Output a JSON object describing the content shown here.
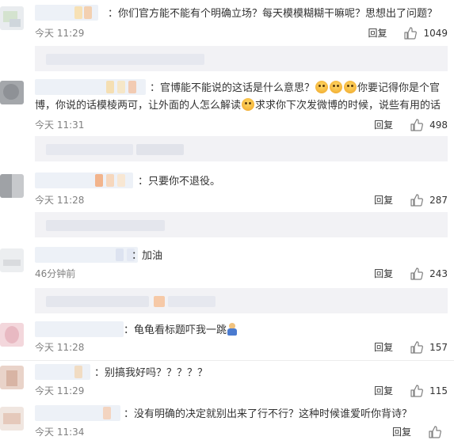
{
  "comments": [
    {
      "text": "你们官方能不能有个明确立场？每天模模糊糊干嘛呢？思想出了问题？",
      "time": "今天 11:29",
      "reply_label": "回复",
      "likes": "1049"
    },
    {
      "text_part1": "官博能不能说的这话是什么意思？",
      "text_part2": "你要记得你是个官博，你说的话模棱两可，让外面的人怎么解读",
      "text_part3": "求求你下次发微博的时候，说些有用的话",
      "time": "今天 11:31",
      "reply_label": "回复",
      "likes": "498"
    },
    {
      "text": "只要你不退役。",
      "time": "今天 11:28",
      "reply_label": "回复",
      "likes": "287"
    },
    {
      "text": "加油",
      "time": "46分钟前",
      "reply_label": "回复",
      "likes": "243"
    },
    {
      "text": "龟龟看标题吓我一跳",
      "time": "今天 11:28",
      "reply_label": "回复",
      "likes": "157"
    },
    {
      "text": "别搞我好吗？？？？？",
      "time": "今天 11:29",
      "reply_label": "回复",
      "likes": "115"
    },
    {
      "text": "没有明确的决定就别出来了行不行？这种时候谁爱听你背诗？",
      "time": "今天 11:34",
      "reply_label": "回复",
      "likes": ""
    }
  ],
  "colon": "：",
  "icons": {
    "thumb": "thumbs-up-icon",
    "emoji": "smiley-emoji-icon",
    "figure": "person-emoji-icon"
  },
  "colors": {
    "text": "#333333",
    "meta": "#808080",
    "preview_bg": "#f2f2f5",
    "divider": "#ececec"
  }
}
